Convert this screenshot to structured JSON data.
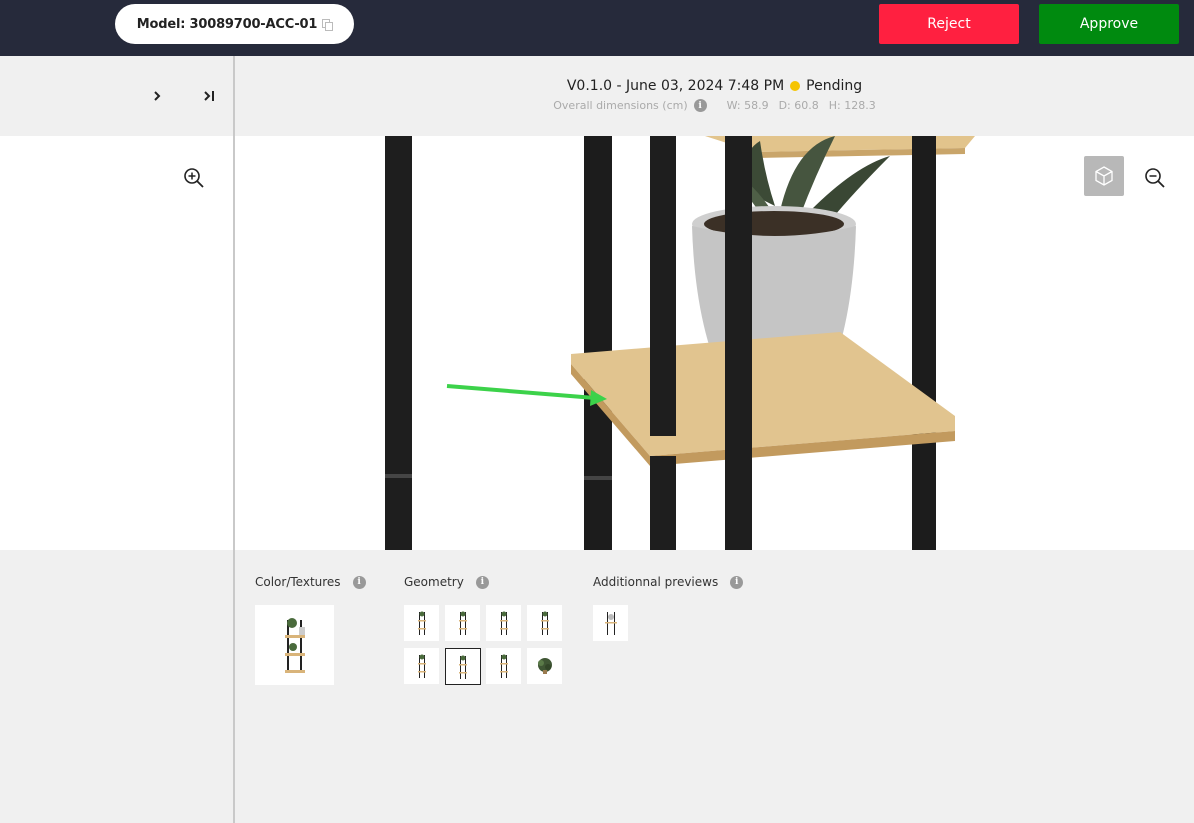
{
  "topbar": {
    "model_label": "Model: 30089700-ACC-01",
    "reject_label": "Reject",
    "approve_label": "Approve"
  },
  "header": {
    "version": "V0.1.0 - June 03, 2024 7:48 PM",
    "status": "Pending",
    "dims_label": "Overall dimensions (cm)",
    "width": "W: 58.9",
    "depth": "D: 60.8",
    "height": "H: 128.3"
  },
  "panel": {
    "color_textures_label": "Color/Textures",
    "geometry_label": "Geometry",
    "additional_label": "Additionnal previews",
    "geometry_selected_index": 5
  },
  "colors": {
    "reject": "#ff2040",
    "approve": "#008a0f",
    "pending": "#f5c400",
    "topbar": "#262a3b"
  }
}
